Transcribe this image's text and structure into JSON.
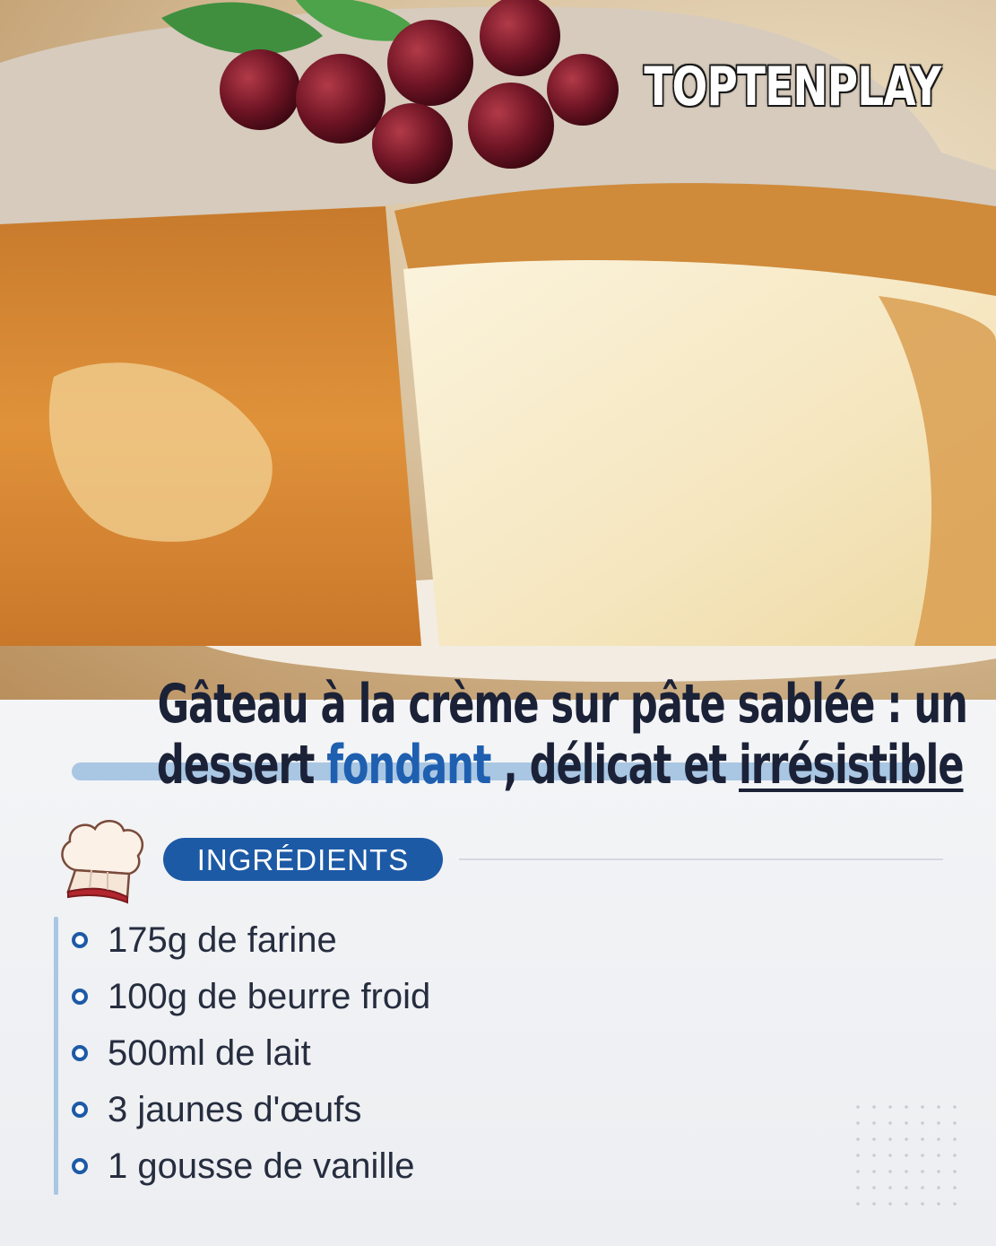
{
  "brand": {
    "watermark": "TOPTENPLAY"
  },
  "title": {
    "line1": "Gâteau à la crème sur pâte sablée : un",
    "line2_part1": "dessert ",
    "line2_highlight1": "fondant",
    "line2_part2": " , délicat et ",
    "line2_highlight2": "irrésistible"
  },
  "ingredients": {
    "badge": "INGRÉDIENTS",
    "items": [
      "175g de farine",
      "100g de beurre froid",
      "500ml de lait",
      "3 jaunes d'œufs",
      "1 gousse de vanille"
    ]
  },
  "colors": {
    "accent_blue": "#1d5aa6",
    "highlight_blue": "#a9c6e3",
    "title_text": "#1b2237"
  }
}
